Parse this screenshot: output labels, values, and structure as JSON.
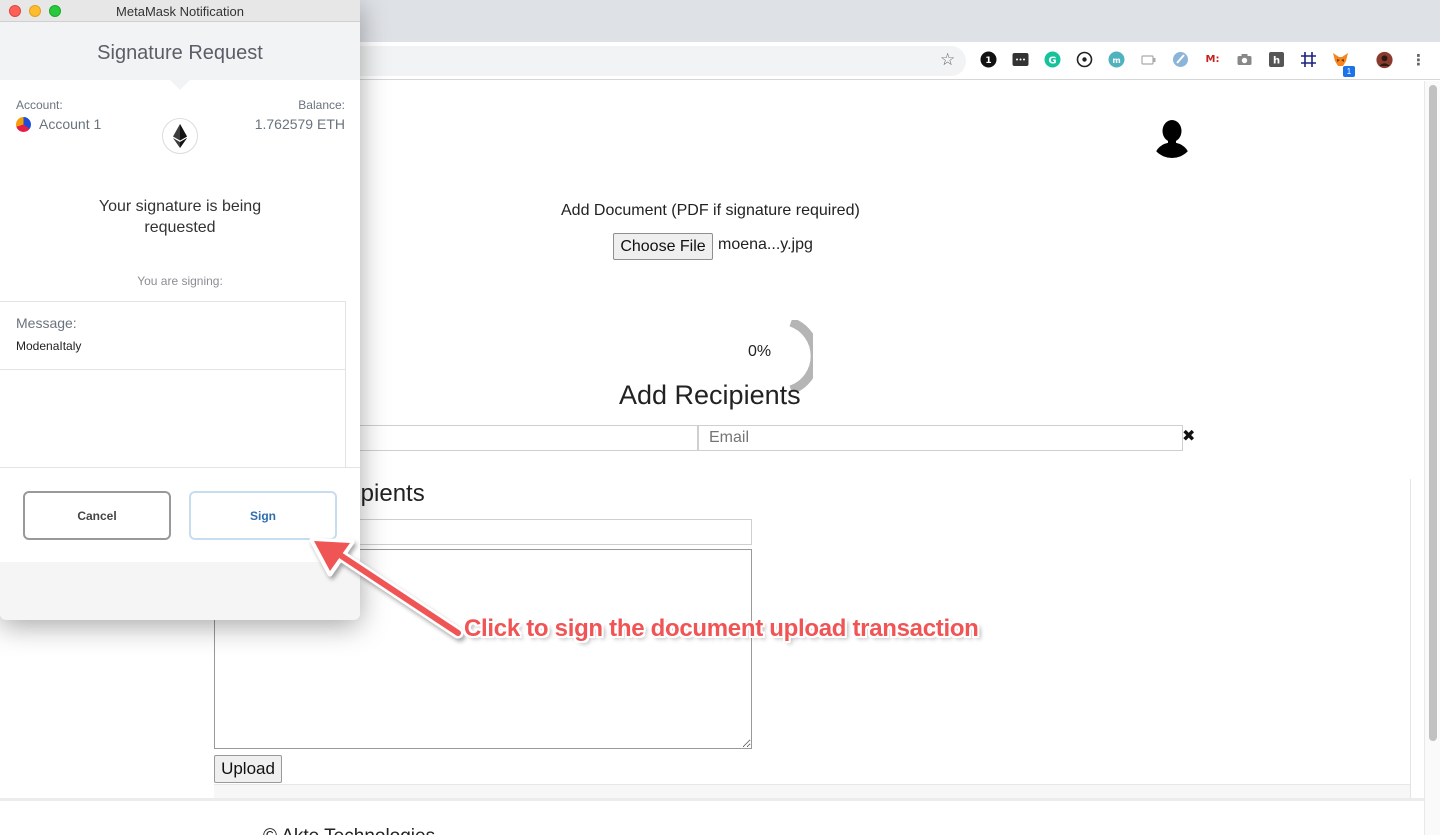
{
  "metamask": {
    "window_title": "MetaMask Notification",
    "heading": "Signature Request",
    "account_label": "Account:",
    "account_name": "Account 1",
    "balance_label": "Balance:",
    "balance_value": "1.762579 ETH",
    "request_text": "Your signature is being requested",
    "signing_label": "You are signing:",
    "message_label": "Message:",
    "message_value": "ModenaItaly",
    "cancel_label": "Cancel",
    "sign_label": "Sign"
  },
  "browser": {
    "extension_icons": [
      "1password-icon",
      "keyboard-icon",
      "grammarly-icon",
      "target-icon",
      "mail-icon",
      "screen-icon",
      "privacy-icon",
      "mega-icon",
      "camera-icon",
      "hunter-icon",
      "grid-icon",
      "metamask-fox-icon"
    ],
    "metamask_badge": "1",
    "accent": "#1a73e8"
  },
  "page": {
    "add_document_label": "Add Document (PDF if signature required)",
    "choose_file_label": "Choose File",
    "file_name": "moena...y.jpg",
    "progress": "0%",
    "add_recipients_heading": "Add Recipients",
    "email_placeholder": "Email",
    "recipients_heading": "ecipients",
    "upload_label": "Upload",
    "footer_text": "© Akte Technologies"
  },
  "annotation": {
    "text": "Click to sign the document upload transaction",
    "color": "#f05454"
  }
}
